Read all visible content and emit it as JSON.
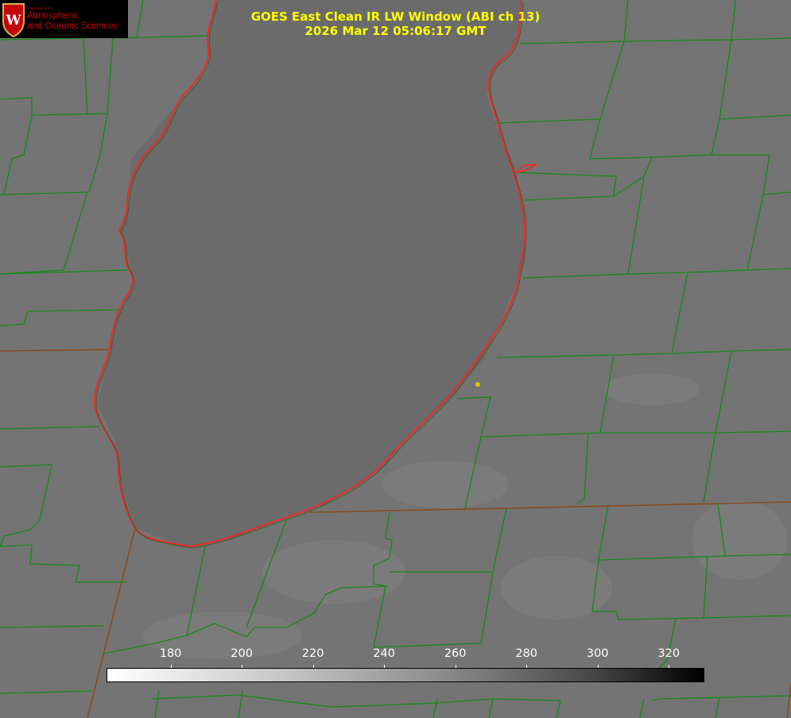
{
  "title": {
    "line1": "GOES East Clean IR LW Window (ABI ch 13)",
    "line2": "2026 Mar 12 05:06:17 GMT"
  },
  "logo": {
    "department_line": "Department of",
    "line1": "Atmospheric",
    "line2": "and Oceanic Sciences",
    "shield_letter": "W"
  },
  "colorbar": {
    "ticks": [
      "180",
      "200",
      "220",
      "240",
      "260",
      "280",
      "300",
      "320"
    ],
    "range": [
      162,
      330
    ]
  },
  "colors": {
    "county_borders": "#138a13",
    "lake_outline": "#ff2020",
    "title_text": "#ffff00",
    "station_marker": "#d4c400",
    "lake_fill": "#6b6b6b",
    "land_fill": "#757575"
  },
  "map_features": [
    "lake-outline",
    "county-borders",
    "state-border",
    "station-marker"
  ]
}
